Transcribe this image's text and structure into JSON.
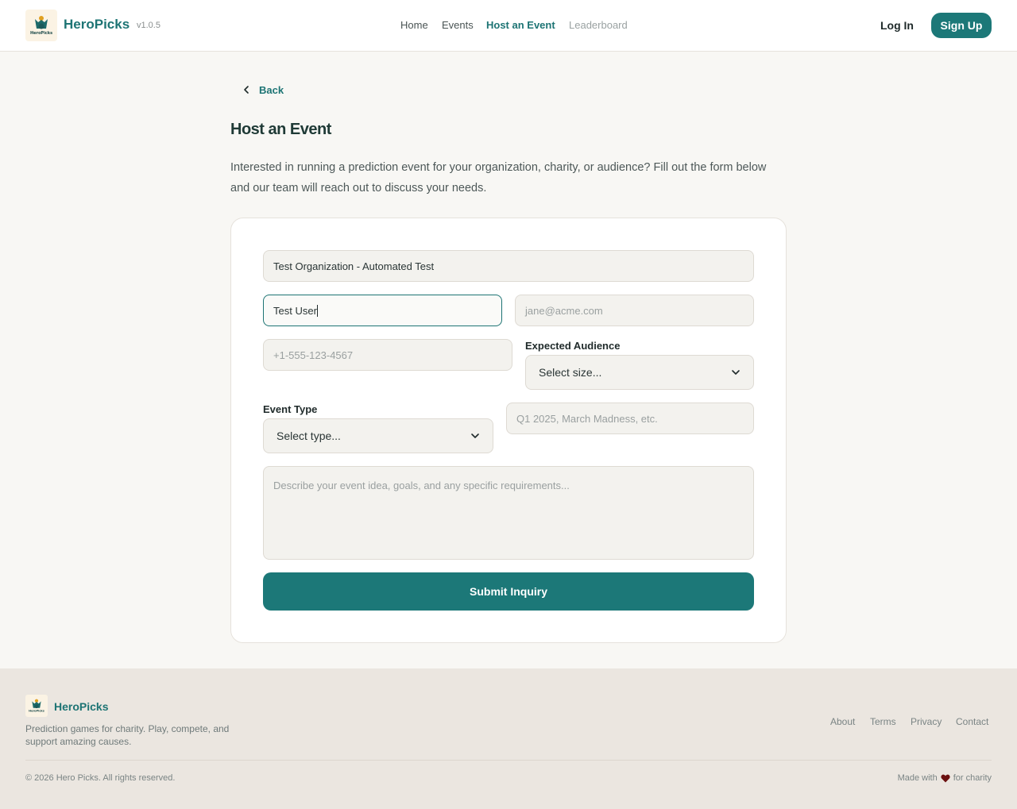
{
  "header": {
    "brand": "HeroPicks",
    "version": "v1.0.5",
    "logo_text": "HeroPicks",
    "nav": [
      {
        "label": "Home"
      },
      {
        "label": "Events"
      },
      {
        "label": "Host an Event"
      },
      {
        "label": "Leaderboard"
      }
    ],
    "login_label": "Log In",
    "signup_label": "Sign Up"
  },
  "main": {
    "back_label": "Back",
    "title": "Host an Event",
    "intro": "Interested in running a prediction event for your organization, charity, or audience? Fill out the form below and our team will reach out to discuss your needs."
  },
  "form": {
    "organization_value": "Test Organization - Automated Test",
    "name_value": "Test User",
    "email_placeholder": "jane@acme.com",
    "phone_placeholder": "+1-555-123-4567",
    "audience_label": "Expected Audience",
    "audience_value": "Select size...",
    "event_type_label": "Event Type",
    "event_type_value": "Select type...",
    "timeframe_placeholder": "Q1 2025, March Madness, etc.",
    "details_placeholder": "Describe your event idea, goals, and any specific requirements...",
    "submit_label": "Submit Inquiry"
  },
  "footer": {
    "brand": "HeroPicks",
    "tagline": "Prediction games for charity. Play, compete, and support amazing causes.",
    "links": [
      {
        "label": "About"
      },
      {
        "label": "Terms"
      },
      {
        "label": "Privacy"
      },
      {
        "label": "Contact"
      }
    ],
    "copyright": "© 2026 Hero Picks. All rights reserved.",
    "made_with_prefix": "Made with",
    "made_with_suffix": "for charity"
  },
  "colors": {
    "accent": "#1c7878",
    "background": "#f8f7f4",
    "footer_bg": "#ebe6e0"
  }
}
